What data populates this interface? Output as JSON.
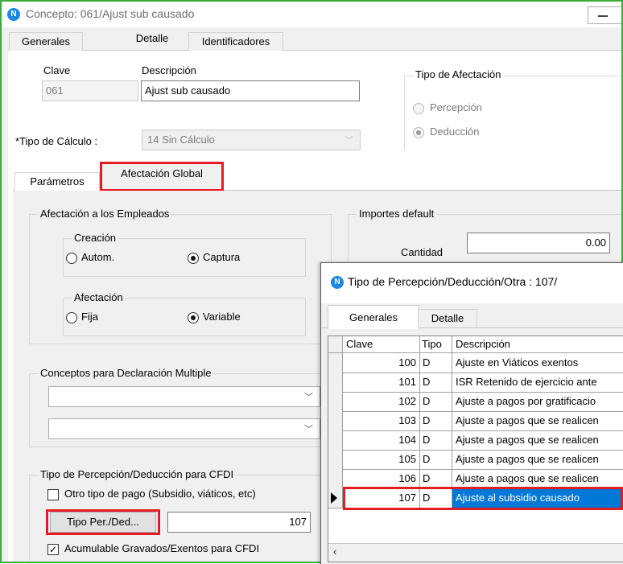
{
  "window": {
    "title": "Concepto:  061/Ajust sub causado",
    "icon": "app-n-icon",
    "minimize_icon": "minimize-icon"
  },
  "tabs": [
    "Generales",
    "Detalle",
    "Identificadores"
  ],
  "form": {
    "clave_label": "Clave",
    "clave_value": "061",
    "descripcion_label": "Descripción",
    "descripcion_value": "Ajust sub causado",
    "tipo_calculo_label": "*Tipo de Cálculo :",
    "tipo_calculo_value": "14 Sin Cálculo",
    "tipo_afectacion": {
      "legend": "Tipo de Afectación",
      "percepcion": "Percepción",
      "deduccion": "Deducción",
      "selected": "Deducción"
    }
  },
  "subtabs": [
    "Parámetros",
    "Afectación Global"
  ],
  "afectacion_empleados": {
    "legend": "Afectación a los Empleados",
    "creacion": {
      "legend": "Creación",
      "autom": "Autom.",
      "captura": "Captura",
      "selected": "Captura"
    },
    "afectacion": {
      "legend": "Afectación",
      "fija": "Fija",
      "variable": "Variable",
      "selected": "Variable"
    }
  },
  "importes_default": {
    "legend": "Importes default",
    "cantidad_label": "Cantidad",
    "cantidad_value": "0.00"
  },
  "declaracion_multiple": {
    "legend": "Conceptos para Declaración Multiple",
    "combo1": "",
    "combo2": ""
  },
  "tipo_cfdi": {
    "legend": "Tipo de Percepción/Deducción para CFDI",
    "otro_tipo": "Otro tipo de pago (Subsidio, viáticos, etc)",
    "otro_tipo_checked": false,
    "button": "Tipo Per./Ded...",
    "value": "107",
    "acumulable": "Acumulable Gravados/Exentos para CFDI",
    "acumulable_checked": true
  },
  "sub_dialog": {
    "title": "Tipo de Percepción/Deducción/Otra :  107/",
    "tabs": [
      "Generales",
      "Detalle"
    ],
    "columns": [
      "Clave",
      "Tipo",
      "Descripción"
    ],
    "rows": [
      {
        "clave": "100",
        "tipo": "D",
        "desc": "Ajuste en Viáticos exentos"
      },
      {
        "clave": "101",
        "tipo": "D",
        "desc": "ISR Retenido de ejercicio ante"
      },
      {
        "clave": "102",
        "tipo": "D",
        "desc": "Ajuste a pagos por gratificacio"
      },
      {
        "clave": "103",
        "tipo": "D",
        "desc": "Ajuste a pagos que se realicen"
      },
      {
        "clave": "104",
        "tipo": "D",
        "desc": "Ajuste a pagos que se realicen"
      },
      {
        "clave": "105",
        "tipo": "D",
        "desc": "Ajuste a pagos que se realicen"
      },
      {
        "clave": "106",
        "tipo": "D",
        "desc": "Ajuste a pagos que se realicen"
      },
      {
        "clave": "107",
        "tipo": "D",
        "desc": "Ajuste al subsidio causado"
      }
    ],
    "selected_clave": "107"
  },
  "colors": {
    "window_border": "#3cab3c",
    "highlight": "#e51b23",
    "selection": "#0078d7"
  }
}
